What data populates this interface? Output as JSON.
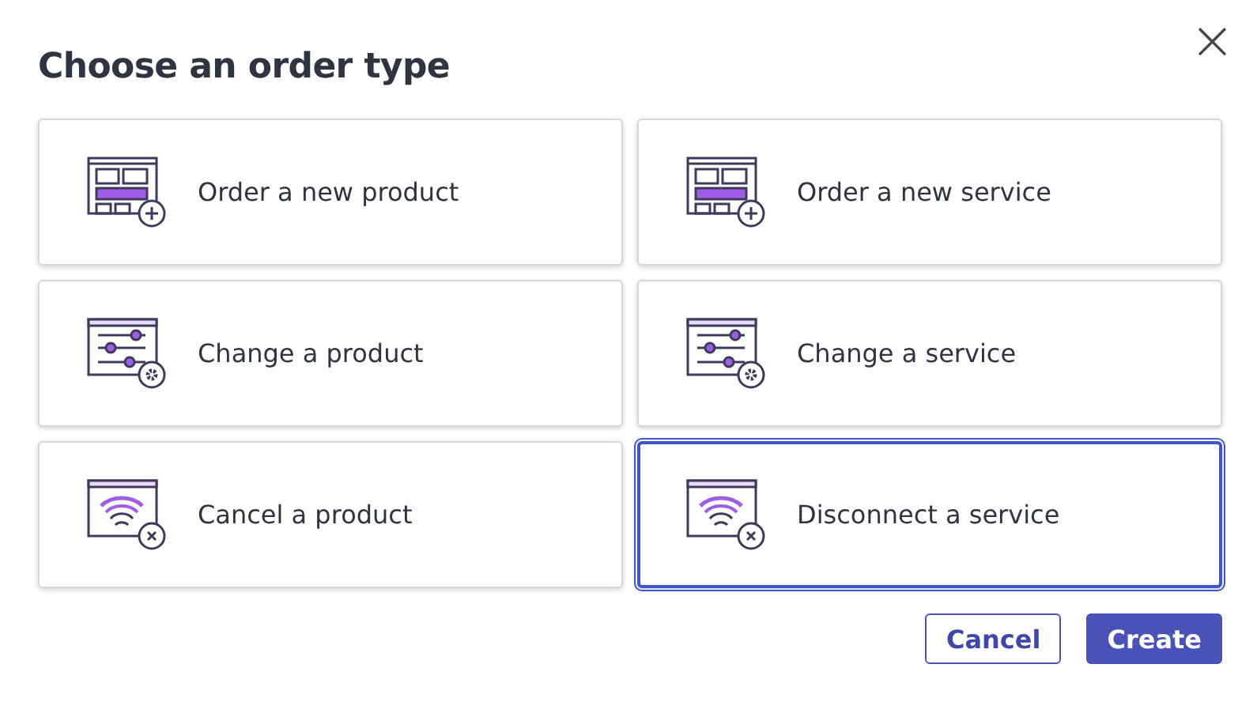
{
  "dialog": {
    "title": "Choose an order type",
    "close": "×"
  },
  "options": [
    {
      "label": "Order a new product",
      "kind": "new",
      "selected": false
    },
    {
      "label": "Order a new service",
      "kind": "new",
      "selected": false
    },
    {
      "label": "Change a product",
      "kind": "change",
      "selected": false
    },
    {
      "label": "Change a service",
      "kind": "change",
      "selected": false
    },
    {
      "label": "Cancel a product",
      "kind": "cancel",
      "selected": false
    },
    {
      "label": "Disconnect a service",
      "kind": "cancel",
      "selected": true
    }
  ],
  "buttons": [
    {
      "label": "Cancel",
      "kind": "secondary"
    },
    {
      "label": "Create",
      "kind": "primary"
    }
  ]
}
